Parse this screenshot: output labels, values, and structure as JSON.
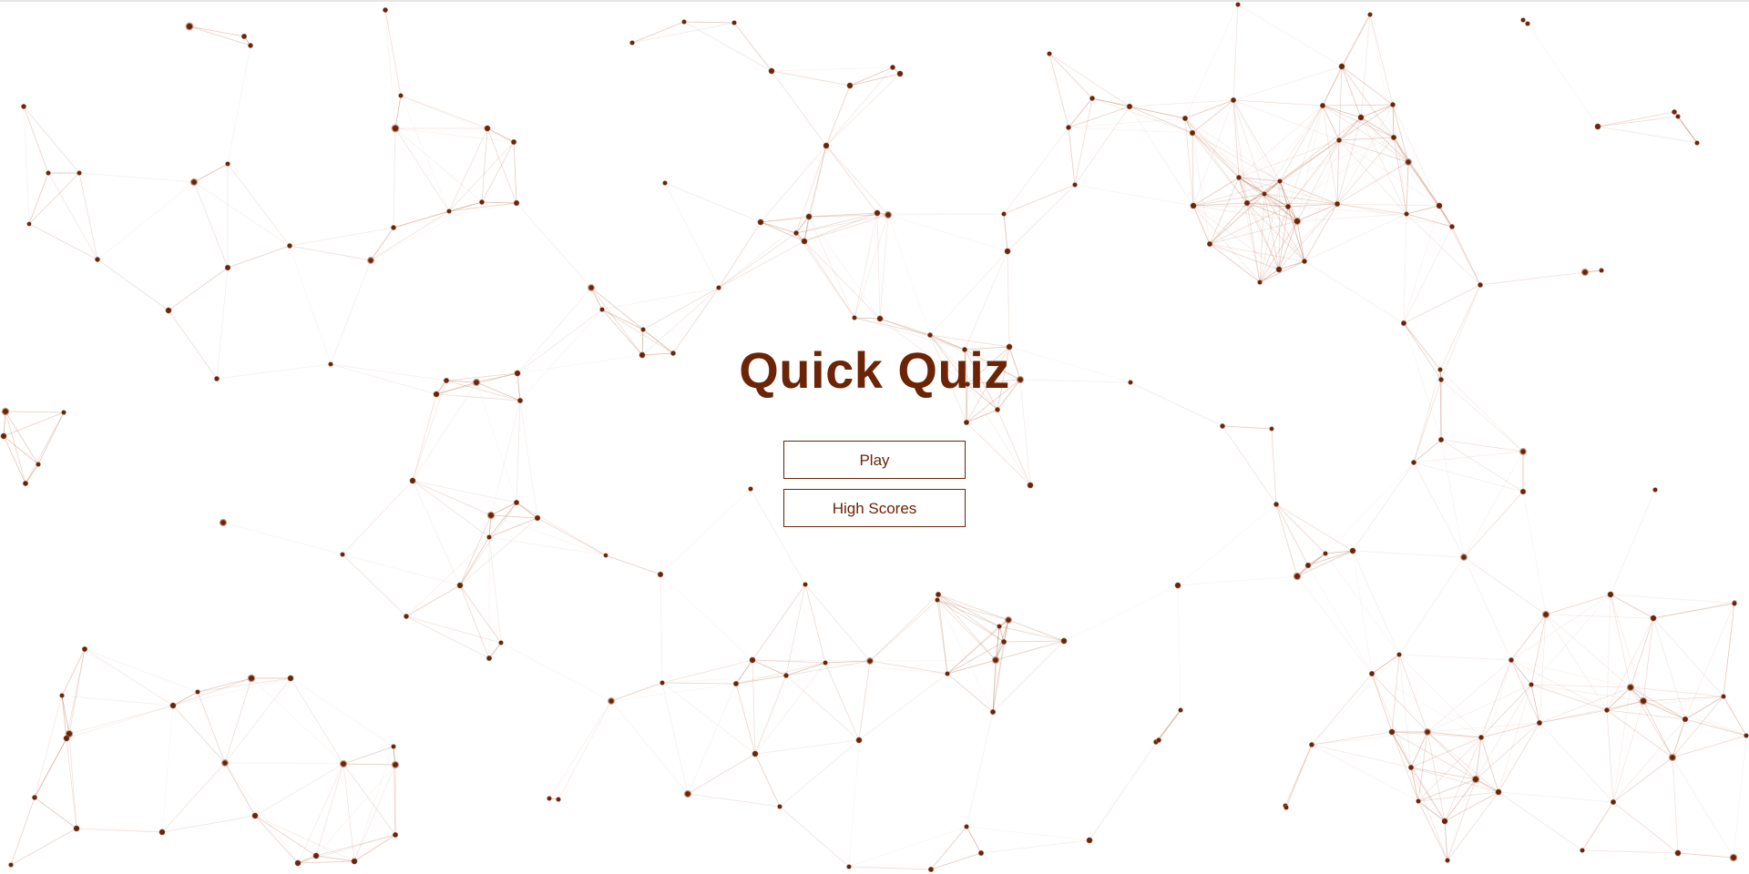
{
  "title": "Quick Quiz",
  "buttons": {
    "play_label": "Play",
    "high_scores_label": "High Scores"
  },
  "colors": {
    "accent": "#6b2406",
    "node": "#6b2406",
    "edge": "#b2694a",
    "background": "#ffffff"
  }
}
